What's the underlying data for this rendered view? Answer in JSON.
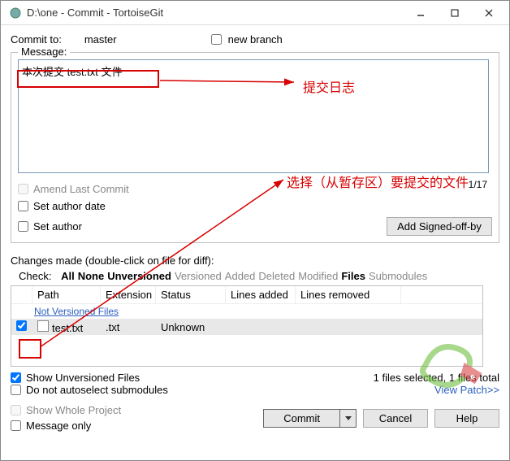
{
  "window": {
    "title": "D:\\one - Commit - TortoiseGit"
  },
  "top": {
    "commit_to_label": "Commit to:",
    "branch": "master",
    "new_branch": "new branch"
  },
  "message": {
    "legend": "Message:",
    "text": "本次提交 test.txt 文件",
    "counter": "1/17",
    "amend": "Amend Last Commit",
    "set_author_date": "Set author date",
    "set_author": "Set author",
    "signed_off": "Add Signed-off-by"
  },
  "changes": {
    "label": "Changes made (double-click on file for diff):",
    "check_label": "Check:",
    "all": "All",
    "none": "None",
    "unversioned": "Unversioned",
    "versioned": "Versioned",
    "added": "Added",
    "deleted": "Deleted",
    "modified": "Modified",
    "files_h": "Files",
    "submodules": "Submodules",
    "cols": {
      "path": "Path",
      "ext": "Extension",
      "status": "Status",
      "la": "Lines added",
      "lr": "Lines removed"
    },
    "group": "Not Versioned Files",
    "rows": [
      {
        "path": "test.txt",
        "ext": ".txt",
        "status": "Unknown",
        "checked": true
      }
    ],
    "show_unv": "Show Unversioned Files",
    "no_autoselect": "Do not autoselect submodules",
    "selected_total": "1 files selected, 1 files total",
    "view_patch": "View Patch>>",
    "show_whole": "Show Whole Project",
    "message_only": "Message only"
  },
  "buttons": {
    "commit": "Commit",
    "cancel": "Cancel",
    "help": "Help"
  },
  "annotations": {
    "a1": "提交日志",
    "a2": "选择（从暂存区）要提交的文件"
  }
}
